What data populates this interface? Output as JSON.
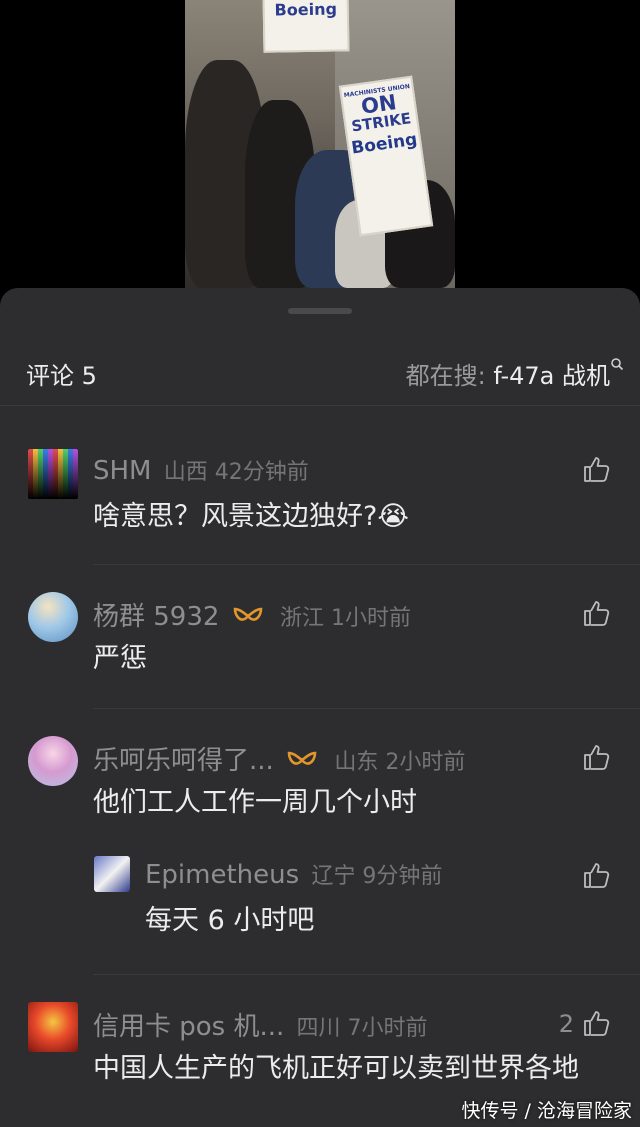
{
  "video": {
    "sign_top_text": "Boeing",
    "sign_main_line1": "ON",
    "sign_main_line2": "STRIKE",
    "sign_main_line3": "Boeing",
    "sign_small_text": "MACHINISTS UNION"
  },
  "header": {
    "comment_label": "评论 5",
    "search_prefix": "都在搜: ",
    "search_term": "f-47a 战机"
  },
  "comments": [
    {
      "name": "SHM",
      "region": "山西 42分钟前",
      "text": "啥意思？风景这边独好?😭"
    },
    {
      "name": "杨群 5932",
      "region": "浙江 1小时前",
      "text": "严惩"
    },
    {
      "name": "乐呵乐呵得了...",
      "region": "山东 2小时前",
      "text": "他们工人工作一周几个小时",
      "reply": {
        "name": "Epimetheus",
        "region": "辽宁 9分钟前",
        "text": "每天 6 小时吧"
      }
    },
    {
      "name": "信用卡 pos 机...",
      "region": "四川 7小时前",
      "likes": "2",
      "text": "中国人生产的飞机正好可以卖到世界各地"
    }
  ],
  "watermark": "快传号 / 沧海冒险家",
  "colors": {
    "sheet_bg": "#2d2d2f",
    "badge": "#e0962a"
  }
}
